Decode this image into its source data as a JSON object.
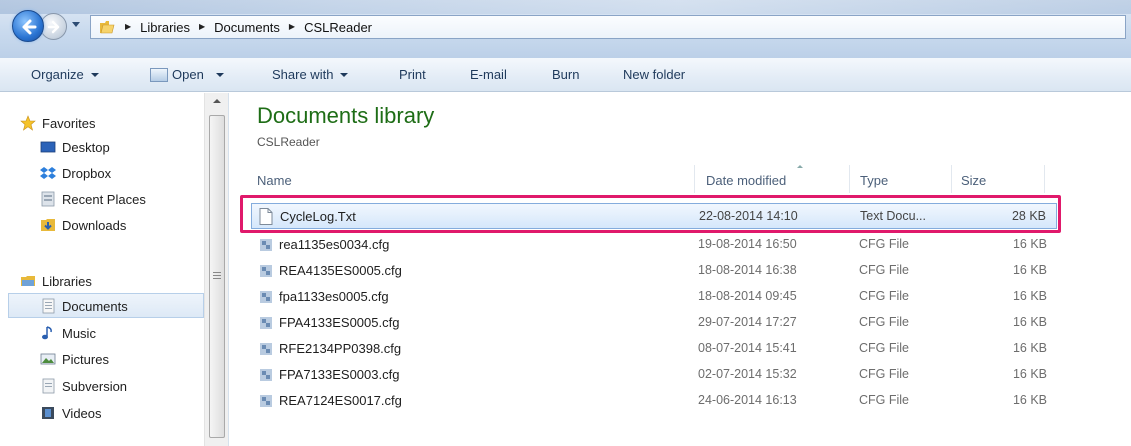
{
  "address": {
    "breadcrumbs": [
      "Libraries",
      "Documents",
      "CSLReader"
    ]
  },
  "toolbar": {
    "organize": "Organize",
    "open": "Open",
    "share_with": "Share with",
    "print": "Print",
    "email": "E-mail",
    "burn": "Burn",
    "new_folder": "New folder"
  },
  "nav": {
    "favorites": "Favorites",
    "desktop": "Desktop",
    "dropbox": "Dropbox",
    "recent_places": "Recent Places",
    "downloads": "Downloads",
    "libraries": "Libraries",
    "documents": "Documents",
    "music": "Music",
    "pictures": "Pictures",
    "subversion": "Subversion",
    "videos": "Videos"
  },
  "library": {
    "title": "Documents library",
    "subtitle": "CSLReader"
  },
  "columns": {
    "name": "Name",
    "date_modified": "Date modified",
    "type": "Type",
    "size": "Size"
  },
  "files": [
    {
      "name": "CycleLog.Txt",
      "date": "22-08-2014 14:10",
      "type": "Text Docu...",
      "size": "28 KB"
    },
    {
      "name": "rea1135es0034.cfg",
      "date": "19-08-2014 16:50",
      "type": "CFG File",
      "size": "16 KB"
    },
    {
      "name": "REA4135ES0005.cfg",
      "date": "18-08-2014 16:38",
      "type": "CFG File",
      "size": "16 KB"
    },
    {
      "name": "fpa1133es0005.cfg",
      "date": "18-08-2014 09:45",
      "type": "CFG File",
      "size": "16 KB"
    },
    {
      "name": "FPA4133ES0005.cfg",
      "date": "29-07-2014 17:27",
      "type": "CFG File",
      "size": "16 KB"
    },
    {
      "name": "RFE2134PP0398.cfg",
      "date": "08-07-2014 15:41",
      "type": "CFG File",
      "size": "16 KB"
    },
    {
      "name": "FPA7133ES0003.cfg",
      "date": "02-07-2014 15:32",
      "type": "CFG File",
      "size": "16 KB"
    },
    {
      "name": "REA7124ES0017.cfg",
      "date": "24-06-2014 16:13",
      "type": "CFG File",
      "size": "16 KB"
    }
  ],
  "colors": {
    "highlight": "#e0196b",
    "library_title": "#1e6d16",
    "selection": "#d5e7fb"
  }
}
